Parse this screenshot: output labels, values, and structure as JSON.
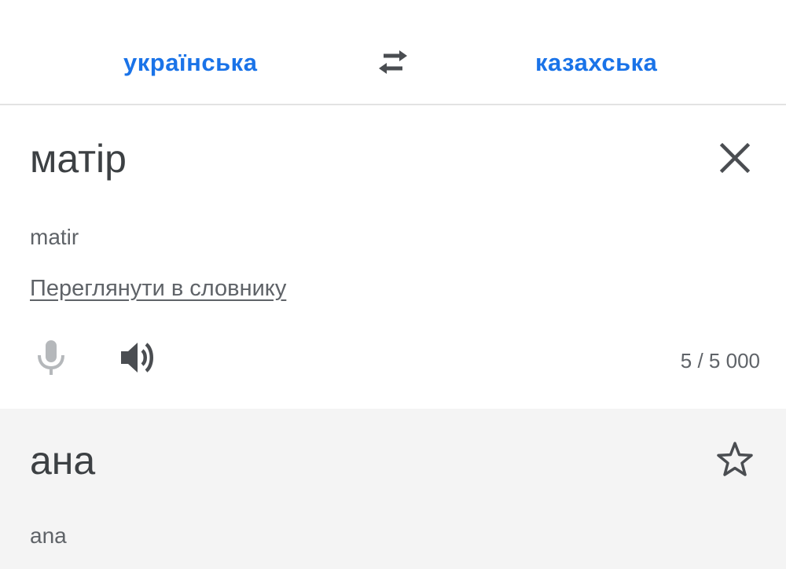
{
  "language_bar": {
    "source_language": "українська",
    "target_language": "казахська",
    "swap_icon": "swap-arrows-icon",
    "accent_color": "#1a73e8"
  },
  "source": {
    "text": "матір",
    "transliteration": "matir",
    "dictionary_link": "Переглянути в словнику",
    "char_count": "5 / 5 000",
    "icons": {
      "clear": "close-icon",
      "mic": "microphone-icon",
      "speaker": "speaker-icon"
    }
  },
  "result": {
    "text": "ана",
    "transliteration": "ana",
    "icons": {
      "star": "star-outline-icon"
    },
    "background_color": "#f4f4f4"
  }
}
